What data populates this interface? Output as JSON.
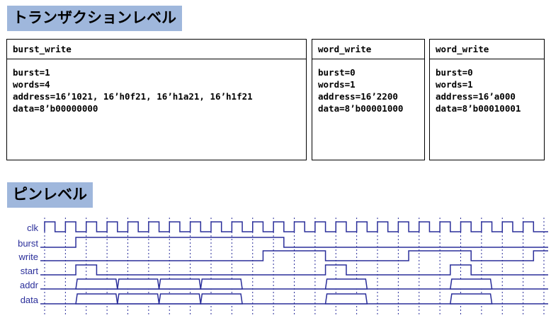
{
  "titles": {
    "transaction": "トランザクションレベル",
    "pin": "ピンレベル"
  },
  "transactions": [
    {
      "name": "burst_write",
      "lines": [
        "burst=1",
        "words=4",
        "address=16’1021, 16’h0f21, 16’h1a21, 16’h1f21",
        "data=8’b00000000"
      ]
    },
    {
      "name": "word_write",
      "lines": [
        "burst=0",
        "words=1",
        "address=16’2200",
        "data=8’b00001000"
      ]
    },
    {
      "name": "word_write",
      "lines": [
        "burst=0",
        "words=1",
        "address=16’a000",
        "data=8’b00010001"
      ]
    }
  ],
  "timing": {
    "signals": [
      "clk",
      "burst",
      "write",
      "start",
      "addr",
      "data"
    ],
    "colors": {
      "signal": "#2a2e9a",
      "grid": "#2a2e9a",
      "label": "#2a2e9a"
    },
    "clock_cycles": 24,
    "waves": {
      "burst": [
        0,
        1,
        1,
        1,
        1,
        1,
        1,
        1,
        1,
        1,
        1,
        0,
        0,
        0,
        0,
        0,
        0,
        0,
        0,
        0,
        0,
        0,
        0,
        0
      ],
      "write": [
        0,
        0,
        0,
        0,
        0,
        0,
        0,
        0,
        0,
        0,
        1,
        1,
        1,
        0,
        0,
        0,
        0,
        1,
        1,
        1,
        0,
        0,
        0,
        1
      ],
      "start": [
        0,
        1,
        0,
        0,
        0,
        0,
        0,
        0,
        0,
        0,
        0,
        0,
        0,
        1,
        0,
        0,
        0,
        0,
        0,
        1,
        0,
        0,
        0,
        0
      ],
      "addr": [
        [
          2,
          4
        ],
        [
          4,
          6
        ],
        [
          6,
          8
        ],
        [
          8,
          10
        ],
        [
          14,
          16
        ],
        [
          20,
          22
        ]
      ],
      "data": [
        [
          2,
          4
        ],
        [
          4,
          6
        ],
        [
          6,
          8
        ],
        [
          8,
          10
        ],
        [
          14,
          16
        ],
        [
          20,
          22
        ]
      ]
    }
  }
}
